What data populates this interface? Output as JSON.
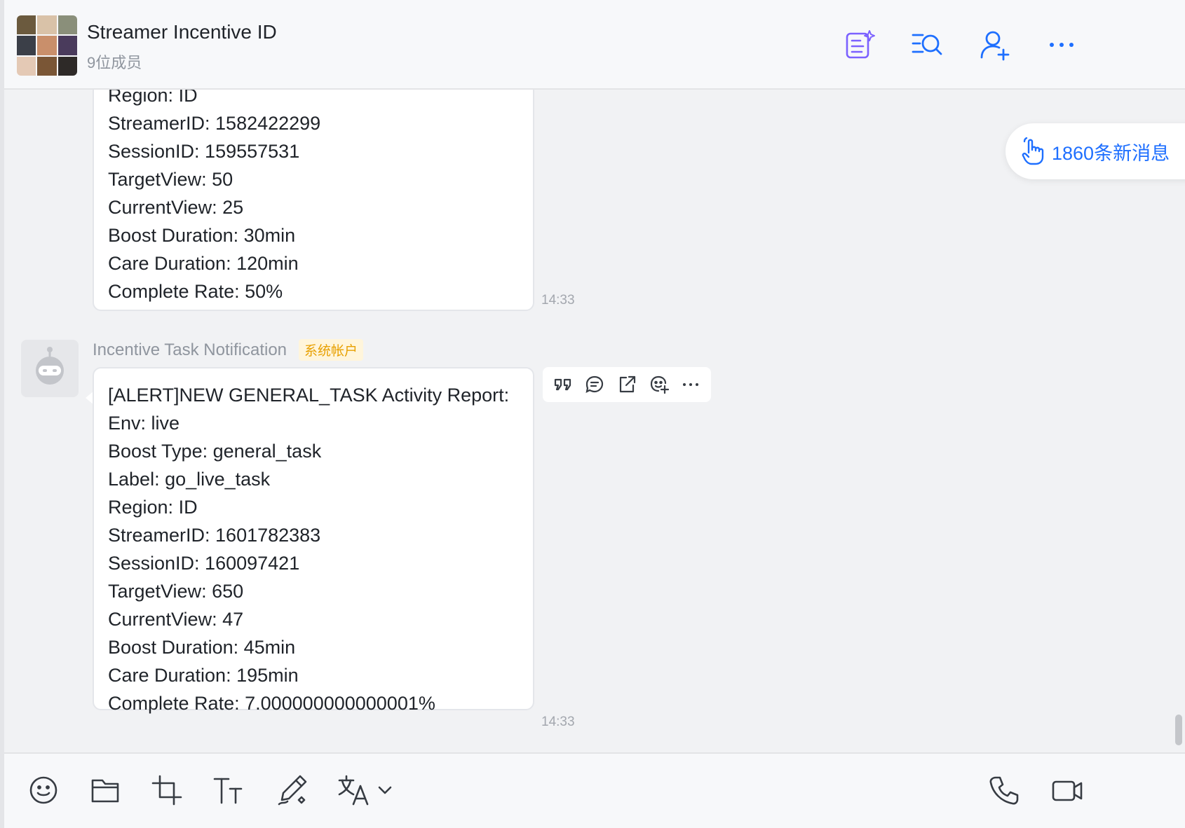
{
  "header": {
    "title": "Streamer Incentive ID",
    "member_count": "9位成员"
  },
  "messages": [
    {
      "lines": [
        "Region: ID",
        "StreamerID: 1582422299",
        "SessionID: 159557531",
        "TargetView: 50",
        "CurrentView: 25",
        "Boost Duration: 30min",
        "Care Duration: 120min",
        "Complete Rate: 50%"
      ],
      "time": "14:33"
    },
    {
      "sender": "Incentive Task Notification",
      "badge": "系统帐户",
      "lines": [
        "[ALERT]NEW GENERAL_TASK Activity Report:",
        "Env: live",
        "Boost Type: general_task",
        "Label: go_live_task",
        "Region: ID",
        "StreamerID: 1601782383",
        "SessionID: 160097421",
        "TargetView: 650",
        "CurrentView: 47",
        "Boost Duration: 45min",
        "Care Duration: 195min",
        "Complete Rate: 7.000000000000001%"
      ],
      "time": "14:33"
    }
  ],
  "new_messages": {
    "label": "1860条新消息"
  },
  "colors": {
    "accent": "#1e6fff",
    "badge_text": "#e8a000",
    "badge_bg": "#fff5db",
    "background": "#f1f2f4"
  },
  "icons": {
    "header": [
      "ai-notes-icon",
      "search-chat-icon",
      "add-member-icon",
      "more-icon"
    ],
    "message_actions": [
      "quote-icon",
      "reply-icon",
      "forward-icon",
      "reaction-icon",
      "more-icon"
    ],
    "toolbar_left": [
      "emoji-icon",
      "folder-icon",
      "screenshot-icon",
      "text-format-icon",
      "draw-icon",
      "translate-icon",
      "chevron-down-icon"
    ],
    "toolbar_right": [
      "phone-icon",
      "video-icon"
    ]
  }
}
